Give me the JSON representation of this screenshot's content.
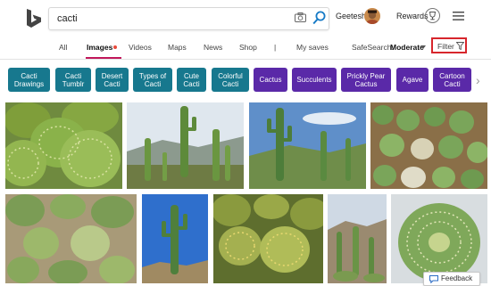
{
  "search": {
    "query": "cacti"
  },
  "header": {
    "user_name": "Geetesh",
    "rewards_label": "Rewards"
  },
  "nav": {
    "tabs": [
      "All",
      "Images",
      "Videos",
      "Maps",
      "News",
      "Shop",
      "|",
      "My saves"
    ],
    "active_tab": "Images",
    "safesearch_label": "SafeSearch:",
    "safesearch_value": "Moderate",
    "filter_label": "Filter"
  },
  "pills": [
    {
      "line1": "Cacti",
      "line2": "Drawings",
      "style": "teal"
    },
    {
      "line1": "Cacti",
      "line2": "Tumblr",
      "style": "teal"
    },
    {
      "line1": "Desert",
      "line2": "Cacti",
      "style": "teal"
    },
    {
      "line1": "Types of",
      "line2": "Cacti",
      "style": "teal"
    },
    {
      "line1": "Cute",
      "line2": "Cacti",
      "style": "teal"
    },
    {
      "line1": "Colorful",
      "line2": "Cacti",
      "style": "teal"
    },
    {
      "line1": "Cactus",
      "line2": "",
      "style": "purple"
    },
    {
      "line1": "Succulents",
      "line2": "",
      "style": "purple"
    },
    {
      "line1": "Prickly Pear",
      "line2": "Cactus",
      "style": "purple"
    },
    {
      "line1": "Agave",
      "line2": "",
      "style": "purple"
    },
    {
      "line1": "Cartoon",
      "line2": "Cacti",
      "style": "purple"
    }
  ],
  "images": {
    "row1": [
      "Barrel cactus cluster",
      "Tall columnar cacti",
      "Saguaro cacti field",
      "Cactus nursery"
    ],
    "row2": [
      "Mixed cacti garden",
      "Saguaro blue sky",
      "Golden barrel cacti",
      "Desert cacti",
      "Large barrel cactus"
    ]
  },
  "feedback_label": "Feedback",
  "colors": {
    "pill_teal": "#17788e",
    "pill_purple": "#5a29a8",
    "active_underline": "#c2185b",
    "filter_border": "#d7262c"
  },
  "icons": {
    "logo": "bing-logo-icon",
    "camera": "camera-icon",
    "search": "search-icon",
    "rewards": "trophy-icon",
    "menu": "hamburger-menu-icon",
    "filter": "filter-funnel-icon",
    "next": "chevron-right-icon",
    "feedback": "feedback-icon"
  }
}
